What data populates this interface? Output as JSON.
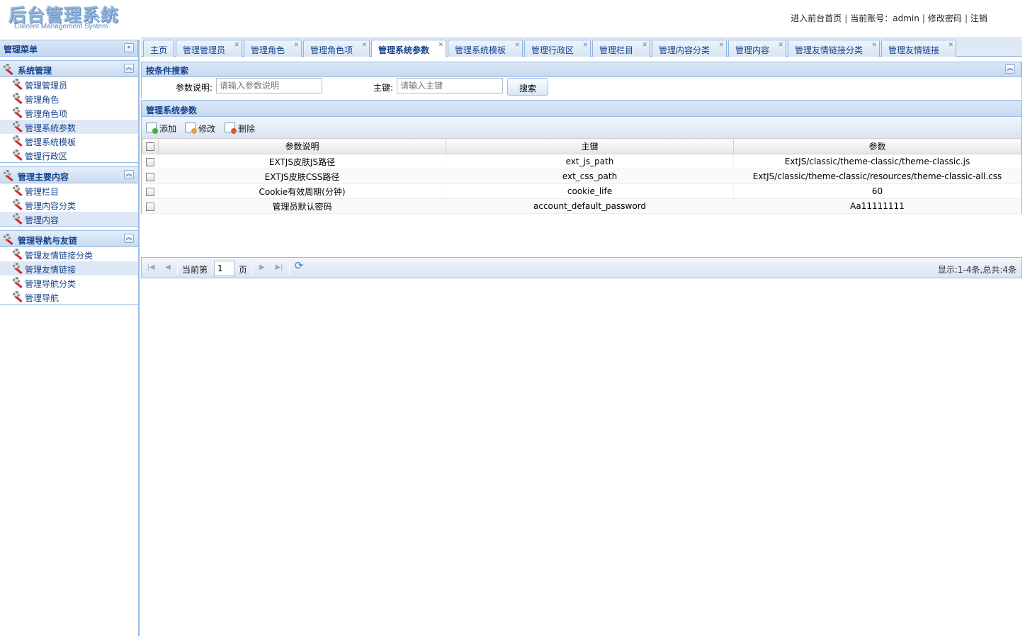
{
  "header": {
    "logo_title": "后台管理系统",
    "logo_subtitle": "Content Management System",
    "links": [
      "进入前台首页",
      "当前账号：admin",
      "修改密码",
      "注销"
    ],
    "separator": "|"
  },
  "nav": {
    "title": "管理菜单",
    "collapse_glyph": "«",
    "groups": [
      {
        "title": "系统管理",
        "items": [
          {
            "label": "管理管理员"
          },
          {
            "label": "管理角色"
          },
          {
            "label": "管理角色项"
          },
          {
            "label": "管理系统参数",
            "active": true
          },
          {
            "label": "管理系统模板"
          },
          {
            "label": "管理行政区"
          }
        ]
      },
      {
        "title": "管理主要内容",
        "items": [
          {
            "label": "管理栏目"
          },
          {
            "label": "管理内容分类"
          },
          {
            "label": "管理内容",
            "active": true
          }
        ]
      },
      {
        "title": "管理导航与友链",
        "items": [
          {
            "label": "管理友情链接分类"
          },
          {
            "label": "管理友情链接",
            "active": true
          },
          {
            "label": "管理导航分类"
          },
          {
            "label": "管理导航"
          }
        ]
      }
    ]
  },
  "tabs": [
    {
      "label": "主页",
      "closable": false
    },
    {
      "label": "管理管理员",
      "closable": true
    },
    {
      "label": "管理角色",
      "closable": true
    },
    {
      "label": "管理角色项",
      "closable": true
    },
    {
      "label": "管理系统参数",
      "closable": true,
      "active": true
    },
    {
      "label": "管理系统模板",
      "closable": true
    },
    {
      "label": "管理行政区",
      "closable": true
    },
    {
      "label": "管理栏目",
      "closable": true
    },
    {
      "label": "管理内容分类",
      "closable": true
    },
    {
      "label": "管理内容",
      "closable": true
    },
    {
      "label": "管理友情链接分类",
      "closable": true
    },
    {
      "label": "管理友情链接",
      "closable": true
    }
  ],
  "search": {
    "title": "按条件搜索",
    "desc_label": "参数说明:",
    "desc_placeholder": "请输入参数说明",
    "key_label": "主键:",
    "key_placeholder": "请输入主键",
    "button": "搜索"
  },
  "grid": {
    "title": "管理系统参数",
    "toolbar": [
      "添加",
      "修改",
      "删除"
    ],
    "columns": [
      "参数说明",
      "主键",
      "参数"
    ],
    "rows": [
      [
        "EXTJS皮肤JS路径",
        "ext_js_path",
        "ExtJS/classic/theme-classic/theme-classic.js"
      ],
      [
        "EXTJS皮肤CSS路径",
        "ext_css_path",
        "ExtJS/classic/theme-classic/resources/theme-classic-all.css"
      ],
      [
        "Cookie有效周期(分钟)",
        "cookie_life",
        "60"
      ],
      [
        "管理员默认密码",
        "account_default_password",
        "Aa11111111"
      ]
    ]
  },
  "pager": {
    "before": "当前第",
    "page": "1",
    "after": "页",
    "info": "显示:1-4条,总共:4条"
  },
  "colors": {
    "accent": "#15428b",
    "border": "#99bbe8",
    "header_bg": "#dae7f6"
  }
}
